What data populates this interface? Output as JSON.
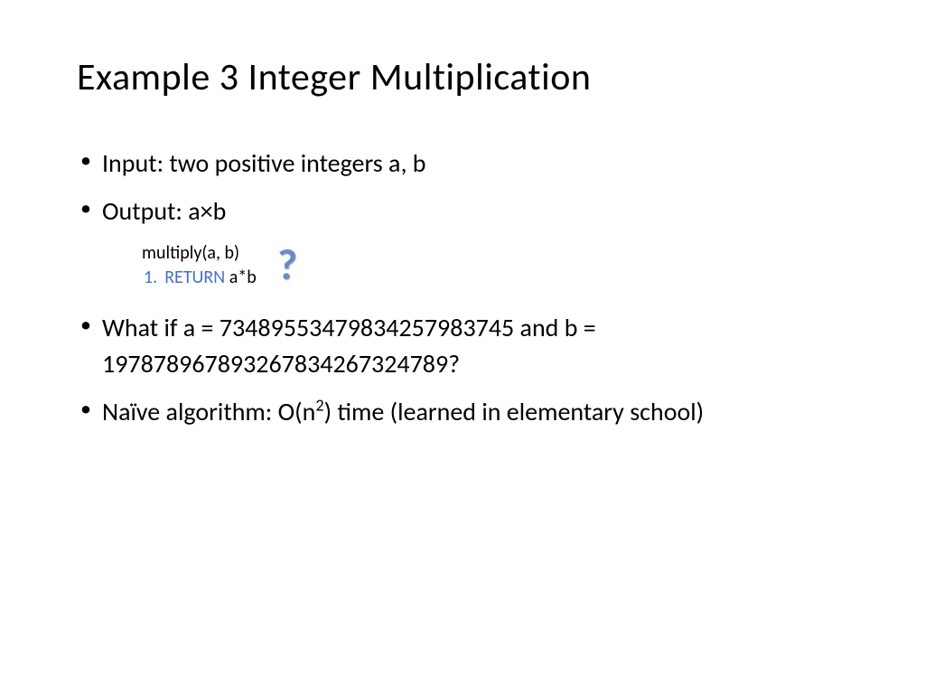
{
  "title": "Example 3 Integer Multiplication",
  "bullets": {
    "b1": "Input: two positive integers a, b",
    "b2": "Output: a×b",
    "b3": "What if a = 73489553479834257983745 and b = 19787896789326783426732​4789?",
    "b4_pre": "Naïve algorithm: O(n",
    "b4_sup": "2",
    "b4_post": ") time (learned in elementary school)"
  },
  "code": {
    "line1": "multiply(a, b)",
    "num": "1.",
    "ret": "RETURN",
    "tail": " a*b"
  },
  "qmark": "?"
}
